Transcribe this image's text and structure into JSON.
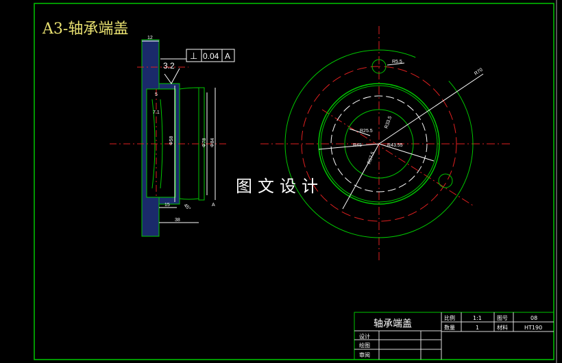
{
  "title": "A3-轴承端盖",
  "watermark": "图文设计",
  "side_view": {
    "dims": [
      "12",
      "5",
      "7.1",
      "Φ58",
      "Φ78",
      "Φ84",
      "15",
      "38",
      "45°"
    ],
    "tolerance": {
      "symbol": "⊥",
      "value": "0.04",
      "datum": "A"
    },
    "roughness": "3.2",
    "datum_label": "A"
  },
  "front_view": {
    "dims": [
      "R5.5",
      "R70",
      "R33.5",
      "R25.5",
      "R45",
      "R43.55",
      "R57.5"
    ]
  },
  "title_block": {
    "part_name": "轴承端盖",
    "labels": {
      "scale": "比例",
      "qty": "数量",
      "drawing_no": "图号",
      "material": "材料",
      "design": "设计",
      "draw": "绘图",
      "review": "审阅"
    },
    "values": {
      "scale": "1:1",
      "qty": "1",
      "drawing_no": "08",
      "material": "HT190"
    }
  },
  "colors": {
    "outline": "#00c800",
    "center": "#e02020",
    "dim": "#ffffff",
    "hatch": "#1a2a6a",
    "title": "#e8e070"
  }
}
